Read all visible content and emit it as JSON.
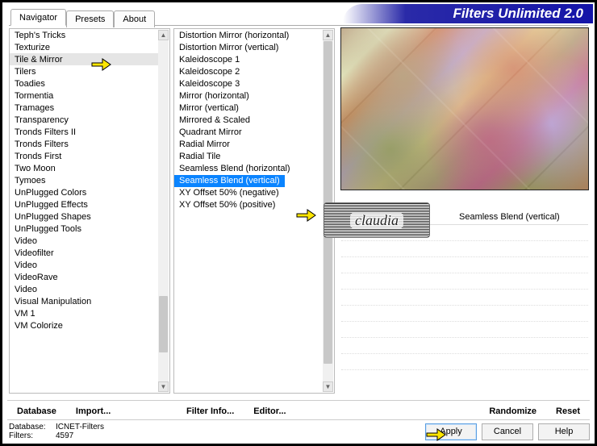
{
  "app_title": "Filters Unlimited 2.0",
  "tabs": [
    "Navigator",
    "Presets",
    "About"
  ],
  "active_tab": 0,
  "categories": [
    "Teph's Tricks",
    "Texturize",
    "Tile & Mirror",
    "Tilers",
    "Toadies",
    "Tormentia",
    "Tramages",
    "Transparency",
    "Tronds Filters II",
    "Tronds Filters",
    "Tronds First",
    "Two Moon",
    "Tymoes",
    "UnPlugged Colors",
    "UnPlugged Effects",
    "UnPlugged Shapes",
    "UnPlugged Tools",
    "Video",
    "Videofilter",
    "Video",
    "VideoRave",
    "Video",
    "Visual Manipulation",
    "VM 1",
    "VM Colorize"
  ],
  "selected_category_index": 2,
  "filters": [
    "Distortion Mirror (horizontal)",
    "Distortion Mirror (vertical)",
    "Kaleidoscope 1",
    "Kaleidoscope 2",
    "Kaleidoscope 3",
    "Mirror (horizontal)",
    "Mirror (vertical)",
    "Mirrored & Scaled",
    "Quadrant Mirror",
    "Radial Mirror",
    "Radial Tile",
    "Seamless Blend (horizontal)",
    "Seamless Blend (vertical)",
    "XY Offset 50% (negative)",
    "XY Offset 50% (positive)"
  ],
  "selected_filter_index": 12,
  "preview_label": "Seamless Blend (vertical)",
  "stamp_text": "claudia",
  "bar1": {
    "database": "Database",
    "import": "Import...",
    "filter_info": "Filter Info...",
    "editor": "Editor...",
    "randomize": "Randomize",
    "reset": "Reset"
  },
  "bar2": {
    "db_label": "Database:",
    "db_value": "ICNET-Filters",
    "filters_label": "Filters:",
    "filters_value": "4597",
    "apply": "Apply",
    "cancel": "Cancel",
    "help": "Help"
  }
}
